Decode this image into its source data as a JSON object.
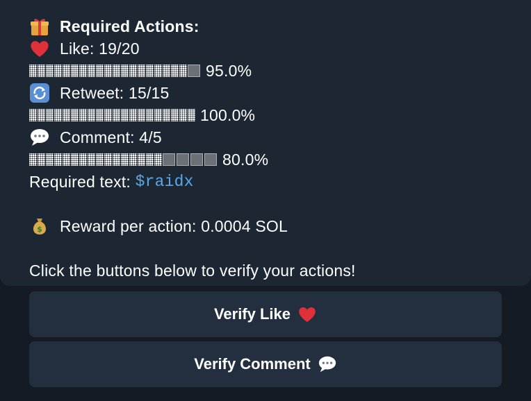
{
  "message": {
    "header": "Required Actions:",
    "like": {
      "label": "Like: 19/20",
      "progress_text": "95.0%",
      "progress": 0.95,
      "icon": "heart-icon"
    },
    "retweet": {
      "label": "Retweet: 15/15",
      "progress_text": "100.0%",
      "progress": 1.0,
      "icon": "retweet-icon"
    },
    "comment": {
      "label": "Comment: 4/5",
      "progress_text": "80.0%",
      "progress": 0.8,
      "icon": "speech-bubble-icon"
    },
    "required_text_label": "Required text: ",
    "required_text_value": "$raidx",
    "reward": "Reward per action: 0.0004 SOL",
    "instruction": "Click the buttons below to verify your actions!"
  },
  "buttons": {
    "verify_like": "Verify Like",
    "verify_comment": "Verify Comment"
  },
  "icons": {
    "header": "gift-icon",
    "reward": "money-bag-icon"
  },
  "colors": {
    "background": "#141b24",
    "bubble": "#1d2733",
    "button": "#232f3e",
    "link": "#5aa7e8",
    "heart": "#e0303a"
  }
}
